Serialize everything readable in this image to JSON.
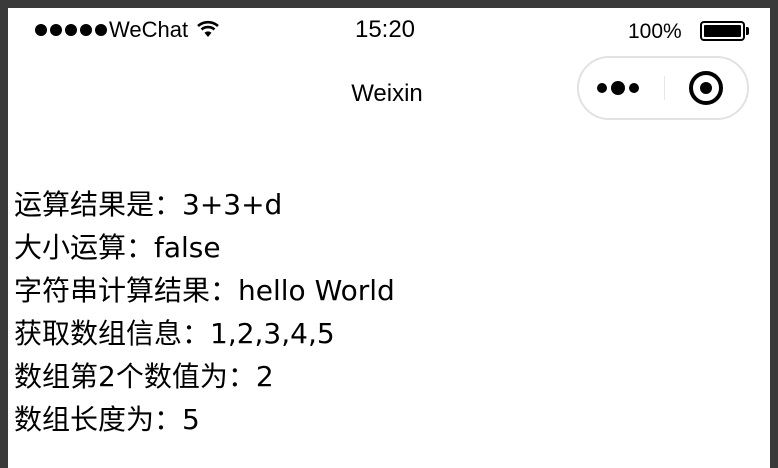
{
  "status_bar": {
    "carrier": "WeChat",
    "time": "15:20",
    "battery": "100%",
    "signal_icon": "signal-dots-icon",
    "wifi_icon": "wifi-icon",
    "battery_icon": "battery-icon",
    "battery_level": 1.0
  },
  "nav_bar": {
    "title": "Weixin",
    "more_icon": "more-dots-icon",
    "close_icon": "target-close-icon"
  },
  "content": {
    "lines": [
      "运算结果是：3+3+d",
      "大小运算：false",
      "字符串计算结果：hello World",
      "获取数组信息：1,2,3,4,5",
      "数组第2个数值为：2",
      "数组长度为：5"
    ]
  },
  "colors": {
    "background": "#ffffff",
    "text": "#000000",
    "capsule_border": "#e2e2e2",
    "outer_frame": "#3a3a3a"
  }
}
